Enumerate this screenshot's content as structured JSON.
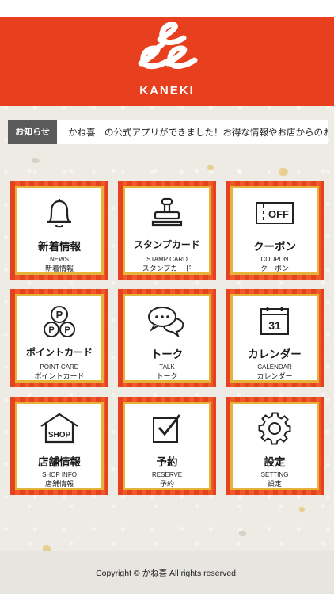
{
  "header": {
    "brand": "KANEKI",
    "colors": {
      "primary": "#e8401f",
      "gold": "#e6b33a"
    }
  },
  "news": {
    "label": "お知らせ",
    "text": "かね喜　の公式アプリができました！お得な情報やお店からのお"
  },
  "menu": [
    {
      "icon": "bell-icon",
      "title": "新着情報",
      "en": "NEWS",
      "ja": "新着情報"
    },
    {
      "icon": "stamp-icon",
      "title": "スタンプカード",
      "en": "STAMP CARD",
      "ja": "スタンプカード"
    },
    {
      "icon": "coupon-icon",
      "title": "クーポン",
      "en": "COUPON",
      "ja": "クーポン",
      "icon_text": "OFF"
    },
    {
      "icon": "point-coins-icon",
      "title": "ポイントカード",
      "en": "POINT CARD",
      "ja": "ポイントカード",
      "icon_text": "P"
    },
    {
      "icon": "chat-bubbles-icon",
      "title": "トーク",
      "en": "TALK",
      "ja": "トーク"
    },
    {
      "icon": "calendar-icon",
      "title": "カレンダー",
      "en": "CALENDAR",
      "ja": "カレンダー",
      "icon_text": "31"
    },
    {
      "icon": "shop-icon",
      "title": "店舗情報",
      "en": "SHOP INFO",
      "ja": "店舗情報",
      "icon_text": "SHOP"
    },
    {
      "icon": "checkbox-icon",
      "title": "予約",
      "en": "RESERVE",
      "ja": "予約"
    },
    {
      "icon": "gear-icon",
      "title": "設定",
      "en": "SETTING",
      "ja": "設定"
    }
  ],
  "footer": {
    "copyright": "Copyright © かね喜 All rights reserved."
  }
}
